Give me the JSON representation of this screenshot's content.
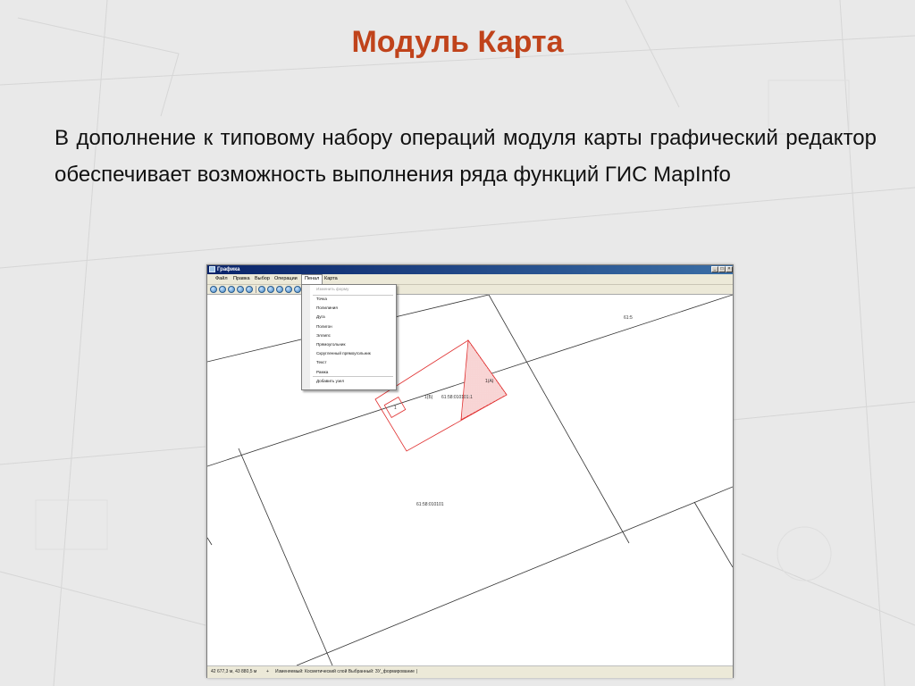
{
  "slide": {
    "title": "Модуль Карта",
    "body": "В дополнение к типовому набору операций модуля карты графический редактор обеспечивает возможность выполнения ряда функций ГИС MapInfo"
  },
  "app": {
    "window_title": "Графика",
    "menu": [
      "Файл",
      "Правка",
      "Выбор",
      "Операции",
      "Пенал",
      "Карта"
    ],
    "active_menu": "Пенал",
    "dropdown_items": [
      {
        "label": "Изменить форму",
        "disabled": true
      },
      {
        "label": "Точка",
        "disabled": false
      },
      {
        "label": "Полилиния",
        "disabled": false
      },
      {
        "label": "Дуга",
        "disabled": false
      },
      {
        "label": "Полигон",
        "disabled": false
      },
      {
        "label": "Эллипс",
        "disabled": false
      },
      {
        "label": "Прямоугольник",
        "disabled": false
      },
      {
        "label": "Скругленный прямоугольник",
        "disabled": false
      },
      {
        "label": "Текст",
        "disabled": false
      },
      {
        "label": "Рамка",
        "disabled": false
      },
      {
        "label": "Добавить узел",
        "disabled": false
      }
    ],
    "map_labels": {
      "parcel_main": "61:58:010101",
      "parcel_b": "1(Б)",
      "parcel_b_number": "61:58:010101:1",
      "parcel_a": "1(А)",
      "small_box": "1",
      "edge_label": "61:5"
    },
    "status": {
      "coords": "42 677,3 м, 43 880,5 м",
      "marker": "+",
      "layers": "Изменяемый: Косметический слой Выбранный: ЗУ_формирование"
    },
    "colors": {
      "title_red": "#c0431b",
      "parcel_red": "#e03030",
      "titlebar_blue": "#0a246a"
    }
  }
}
